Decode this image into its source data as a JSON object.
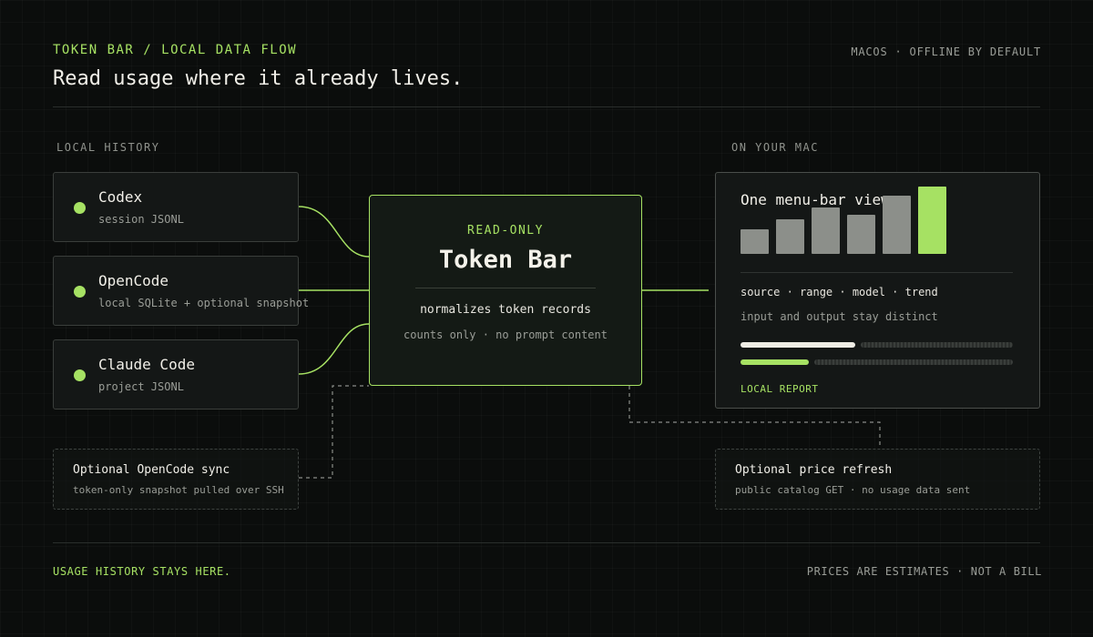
{
  "header": {
    "kicker": "TOKEN BAR / LOCAL DATA FLOW",
    "headline": "Read usage where it already lives.",
    "platform": "MACOS · OFFLINE BY DEFAULT"
  },
  "sections": {
    "local_history": "LOCAL HISTORY",
    "on_your_mac": "ON YOUR MAC"
  },
  "sources": [
    {
      "name": "Codex",
      "detail": "session JSONL"
    },
    {
      "name": "OpenCode",
      "detail": "local SQLite + optional snapshot"
    },
    {
      "name": "Claude Code",
      "detail": "project JSONL"
    }
  ],
  "core": {
    "badge": "READ-ONLY",
    "title": "Token Bar",
    "description": "normalizes token records",
    "note": "counts only · no prompt content"
  },
  "report": {
    "title": "One menu-bar view",
    "bar_levels": [
      0.37,
      0.52,
      0.69,
      0.58,
      0.86,
      1.0
    ],
    "dimensions": "source · range · model · trend",
    "dimensions_note": "input and output stay distinct",
    "progress": [
      0.42,
      0.25
    ],
    "label": "LOCAL REPORT"
  },
  "optional": {
    "sync": {
      "title": "Optional OpenCode sync",
      "detail": "token-only snapshot pulled over SSH"
    },
    "price": {
      "title": "Optional price refresh",
      "detail": "public catalog GET · no usage data sent"
    }
  },
  "footer": {
    "left": "USAGE HISTORY STAYS HERE.",
    "right": "PRICES ARE ESTIMATES · NOT A BILL"
  },
  "colors": {
    "accent": "#a6e163",
    "background": "#0b0d0c",
    "card": "#141716",
    "muted_bar": "#8c8f8a",
    "input_track": "#eeece4"
  }
}
